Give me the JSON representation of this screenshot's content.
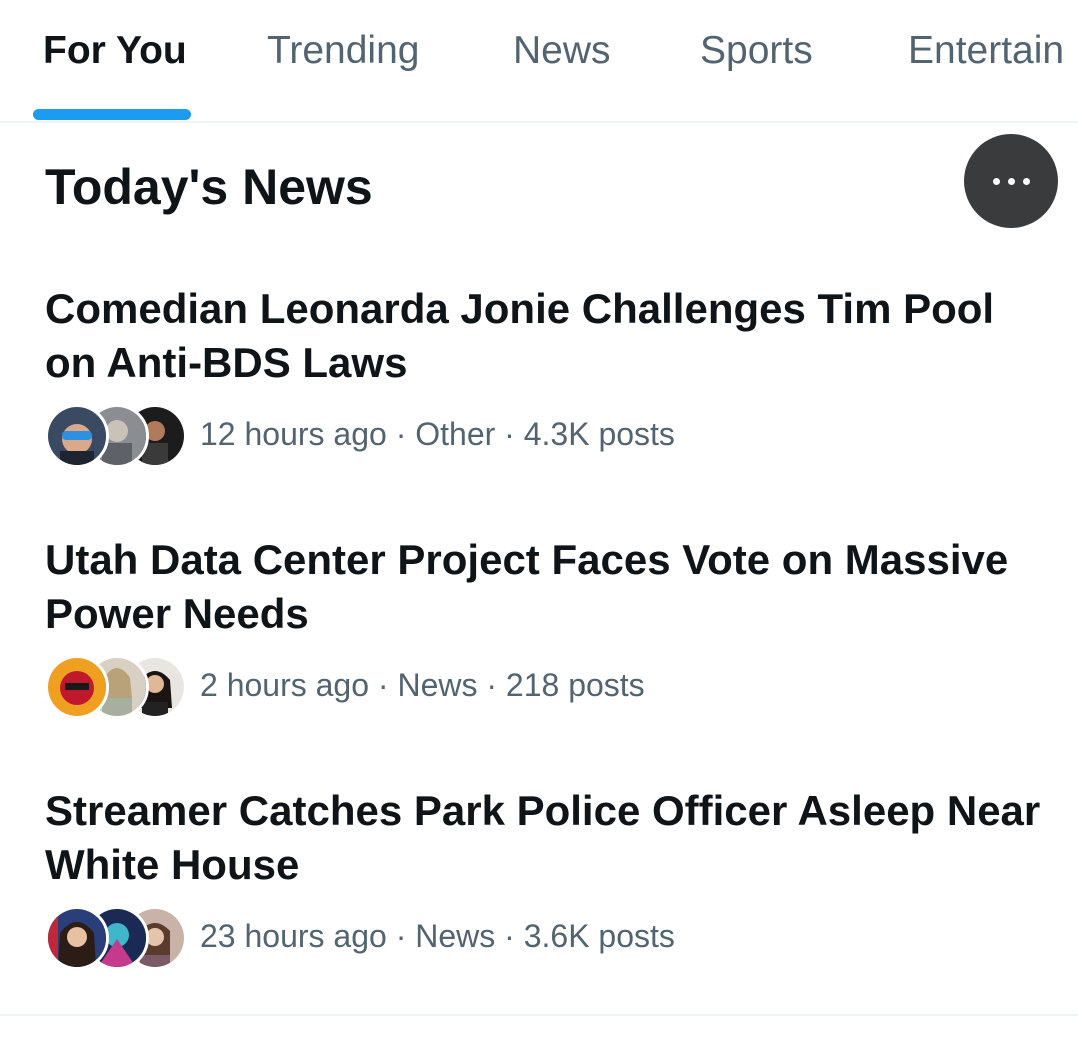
{
  "tabs": [
    {
      "label": "For You",
      "active": true
    },
    {
      "label": "Trending",
      "active": false
    },
    {
      "label": "News",
      "active": false
    },
    {
      "label": "Sports",
      "active": false
    },
    {
      "label": "Entertain",
      "active": false
    }
  ],
  "section": {
    "title": "Today's News",
    "more_icon": "more-horizontal-icon"
  },
  "stories": [
    {
      "headline": "Comedian Leonarda Jonie Challenges Tim Pool on Anti-BDS Laws",
      "meta": "12 hours ago · Other · 4.3K posts",
      "time": "12 hours ago",
      "category": "Other",
      "posts": "4.3K posts"
    },
    {
      "headline": "Utah Data Center Project Faces Vote on Massive Power Needs",
      "meta": "2 hours ago · News · 218 posts",
      "time": "2 hours ago",
      "category": "News",
      "posts": "218 posts"
    },
    {
      "headline": "Streamer Catches Park Police Officer Asleep Near White House",
      "meta": "23 hours ago · News · 3.6K posts",
      "time": "23 hours ago",
      "category": "News",
      "posts": "3.6K posts"
    }
  ],
  "colors": {
    "accent": "#1d9bf0",
    "text_primary": "#0f1419",
    "text_secondary": "#536471",
    "more_button_bg": "#3a3b3c"
  }
}
